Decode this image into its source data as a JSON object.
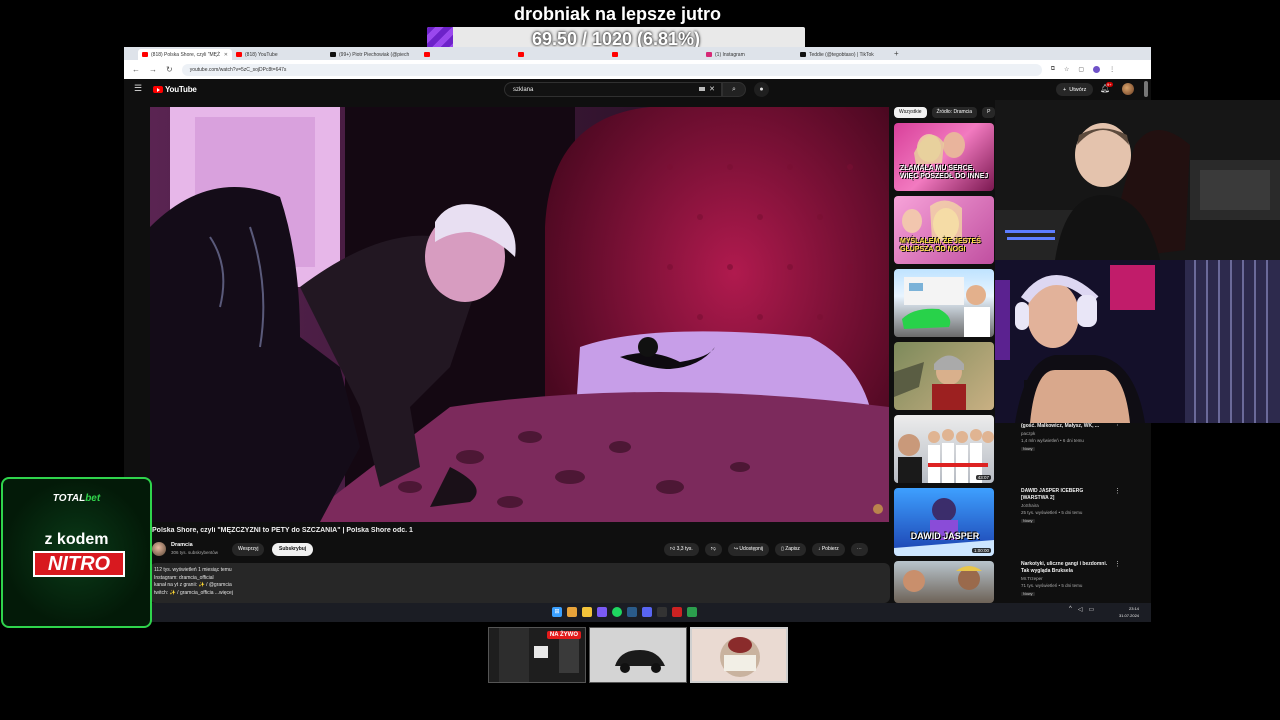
{
  "goal": {
    "title": "drobniak na lepsze jutro",
    "progress_text": "69.50 / 1020 (6.81%)",
    "fraction": 0.0681
  },
  "browser": {
    "tabs": [
      {
        "label": "(818) Polska Shore, czyli \"MĘŻ",
        "favicon": "youtube-icon"
      },
      {
        "label": "(818) YouTube",
        "favicon": "youtube-icon"
      },
      {
        "label": "(99+) Piotr Piechowiak (@piech",
        "favicon": "x-icon"
      },
      {
        "label": "",
        "favicon": "youtube-icon"
      },
      {
        "label": "",
        "favicon": "youtube-icon"
      },
      {
        "label": "",
        "favicon": "youtube-icon"
      },
      {
        "label": "(1) Instagram",
        "favicon": "instagram-icon"
      },
      {
        "label": "Teddie (@tegobtaso) | TikTok",
        "favicon": "tiktok-icon"
      }
    ],
    "url": "youtube.com/watch?v=5zC_sojDPc8t=647s"
  },
  "youtube": {
    "logo_text": "YouTube",
    "search_value": "szklana",
    "create_label": "Utwórz",
    "notifications_count": "9+",
    "video": {
      "title": "Polska Shore, czyli \"MĘŻCZYŹNI to PETY do SZCZANIA\" | Polska Shore odc. 1",
      "channel": "Dramcia",
      "subs": "306 tys. subskrybentów",
      "support": "Wesprzyj",
      "subscribe": "Subskrybuj",
      "likes": "3,3 tys.",
      "share": "Udostępnij",
      "save": "Zapisz",
      "download": "Pobierz",
      "description": [
        "112 tys. wyświetleń  1 miesiąc temu",
        "Instagram: dramcia_official",
        "kanał na yt z granii:  ✨ / @gramcia",
        "twitch:  ✨ / gramcia_officia    ...więcej"
      ]
    },
    "chips": [
      "Wszystkie",
      "Źródło: Dramcia",
      "P"
    ],
    "recommendations": [
      {
        "caption": "ZŁAMAŁA MU SERCE, WIĘC POSZEDŁ DO INNEJ"
      },
      {
        "caption": "MYŚLAŁEM, ŻE JESTEŚ GŁUPSZA OD NOGI"
      },
      {
        "caption": ""
      },
      {
        "caption": ""
      },
      {
        "title": "(gość. Malkowicz, Małysz, WK, ...",
        "channel": "paczpk",
        "meta": "1,4 mln wyświetleń • 6 dni temu",
        "badge": "Nowy",
        "duration": "43:07"
      },
      {
        "caption": "DAWID JASPER",
        "title": "DAWID JASPER ICEBERG [WARSTWA 2]",
        "channel": "JoShaira",
        "meta": "25 tys. wyświetleń • 5 dni temu",
        "badge": "Nowy",
        "duration": "1:00:00"
      },
      {
        "title": "Narkotyki, uliczne gangi i bezdomni. Tak wygląda Bruksela",
        "channel": "Mr.Trzeper",
        "meta": "71 tys. wyświetleń • 5 dni temu",
        "badge": "Nowy"
      }
    ]
  },
  "taskbar": {
    "time": "23:14",
    "date": "31.07.2024"
  },
  "sponsor": {
    "brand_total": "TOTAL",
    "brand_bet": "bet",
    "code_label": "z kodem",
    "code": "NITRO"
  },
  "bottom": {
    "live_label": "NA ŻYWO"
  },
  "colors": {
    "accent_purple": "#7a2fd6",
    "youtube_red": "#ff0000",
    "sponsor_green": "#2fd44c"
  }
}
